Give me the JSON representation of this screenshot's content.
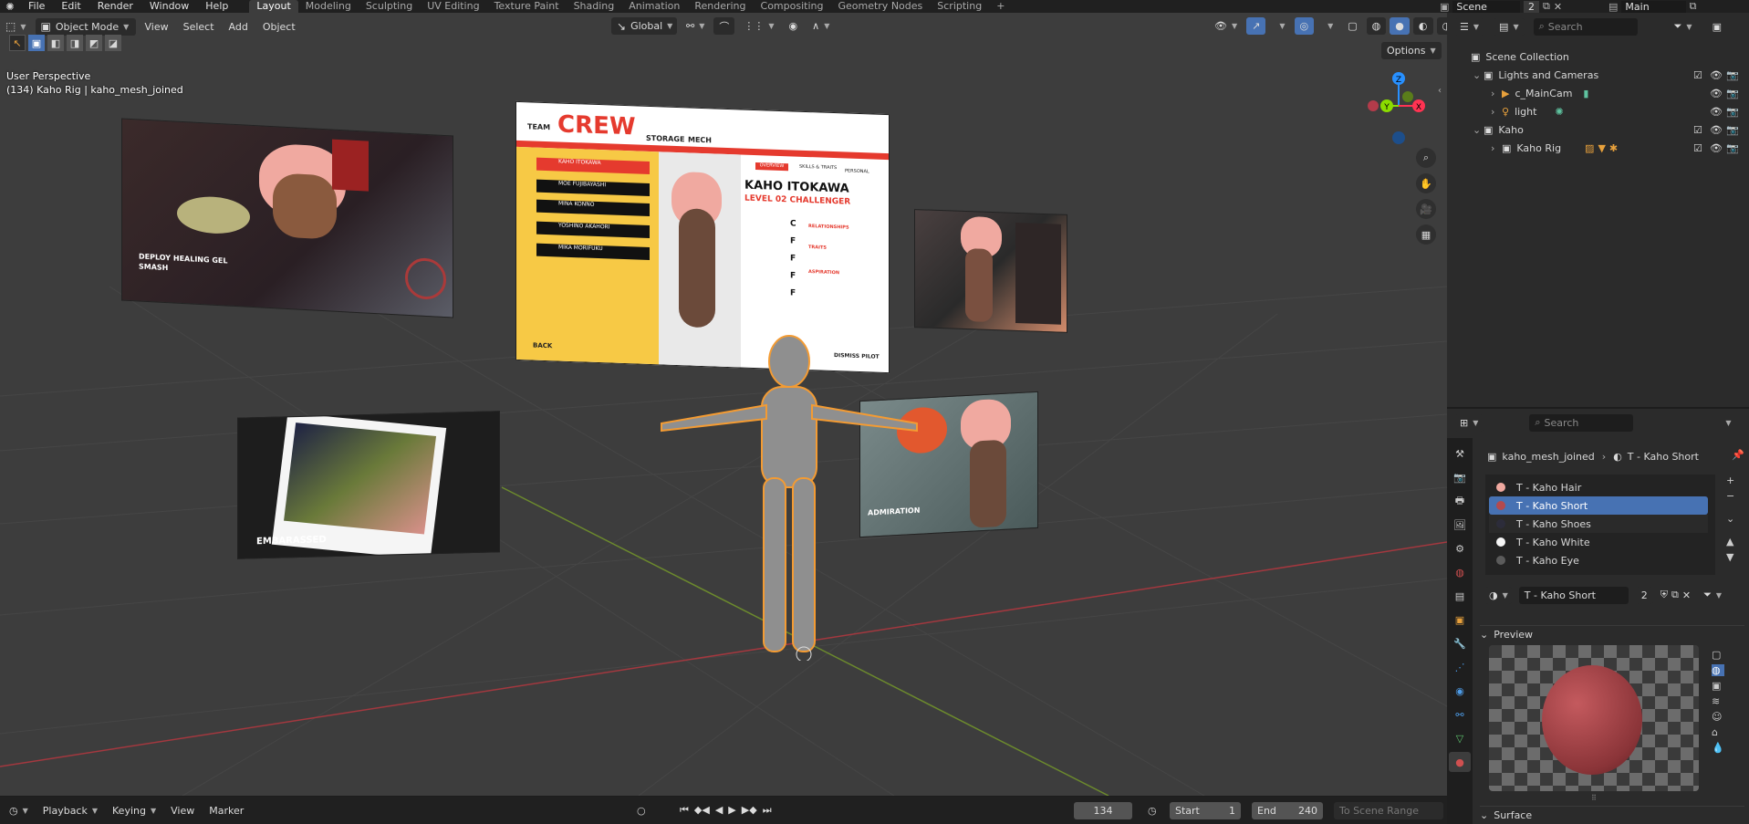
{
  "topbar": {
    "menus": [
      "File",
      "Edit",
      "Render",
      "Window",
      "Help"
    ],
    "workspaces": [
      "Layout",
      "Modeling",
      "Sculpting",
      "UV Editing",
      "Texture Paint",
      "Shading",
      "Animation",
      "Rendering",
      "Compositing",
      "Geometry Nodes",
      "Scripting"
    ],
    "active_workspace": "Layout",
    "scene_name": "Scene",
    "scene_users": "2",
    "view_layer": "Main"
  },
  "viewport_header": {
    "mode": "Object Mode",
    "menus": [
      "View",
      "Select",
      "Add",
      "Object"
    ],
    "orientation": "Global",
    "options_label": "Options"
  },
  "viewport": {
    "view_name": "User Perspective",
    "object_info": "(134) Kaho Rig | kaho_mesh_joined",
    "gizmo_axes": [
      "Z",
      "Y",
      "X"
    ]
  },
  "crew_screen": {
    "team": "TEAM",
    "crew": "CREW",
    "storage": "STORAGE",
    "mech": "MECH",
    "tabs": [
      "OVERVIEW",
      "SKILLS & TRAITS",
      "PERSONAL"
    ],
    "name": "KAHO ITOKAWA",
    "level": "LEVEL 02 CHALLENGER",
    "roster": [
      "KAHO ITOKAWA",
      "MOE FUJIBAYASHI",
      "MINA KONNO",
      "YOSHINO AKAHORI",
      "MIKA MORIFUKU"
    ],
    "grades": [
      "C",
      "F",
      "F",
      "F",
      "F"
    ],
    "sections": [
      "RELATIONSHIPS",
      "TRAITS",
      "ASPIRATION"
    ],
    "back": "BACK",
    "dismiss": "DISMISS PILOT"
  },
  "panels": {
    "top_left_caption": "DEPLOY HEALING GEL",
    "top_left_caption2": "SMASH",
    "bottom_left_caption": "EMBARASSED",
    "bottom_right_caption": "ADMIRATION"
  },
  "outliner": {
    "search_placeholder": "Search",
    "root": "Scene Collection",
    "rows": [
      {
        "label": "Lights and Cameras",
        "type": "collection"
      },
      {
        "label": "c_MainCam",
        "type": "camera"
      },
      {
        "label": "light",
        "type": "light"
      },
      {
        "label": "Kaho",
        "type": "collection"
      },
      {
        "label": "Kaho Rig",
        "type": "armature"
      }
    ]
  },
  "properties": {
    "search_placeholder": "Search",
    "breadcrumb_object": "kaho_mesh_joined",
    "breadcrumb_material": "T - Kaho Short",
    "material_slots": [
      "T - Kaho Hair",
      "T - Kaho Short",
      "T - Kaho Shoes",
      "T - Kaho White",
      "T - Kaho Eye"
    ],
    "selected_slot": "T - Kaho Short",
    "slot_colors": [
      "#f0a9a0",
      "#b44a4e",
      "#2c2c3a",
      "#f5f5f5",
      "#5b5b5b"
    ],
    "material_name": "T - Kaho Short",
    "material_users": "2",
    "preview_label": "Preview",
    "surface_label": "Surface"
  },
  "timeline": {
    "menus": [
      "Playback",
      "Keying",
      "View",
      "Marker"
    ],
    "current_frame": "134",
    "start_label": "Start",
    "start_value": "1",
    "end_label": "End",
    "end_value": "240",
    "to_scene_range": "To Scene Range"
  },
  "colors": {
    "accent": "#4772b3",
    "selection_outline": "#f39b33",
    "x_axis": "#ff3352",
    "y_axis": "#8bdc00",
    "z_axis": "#2890ff"
  }
}
